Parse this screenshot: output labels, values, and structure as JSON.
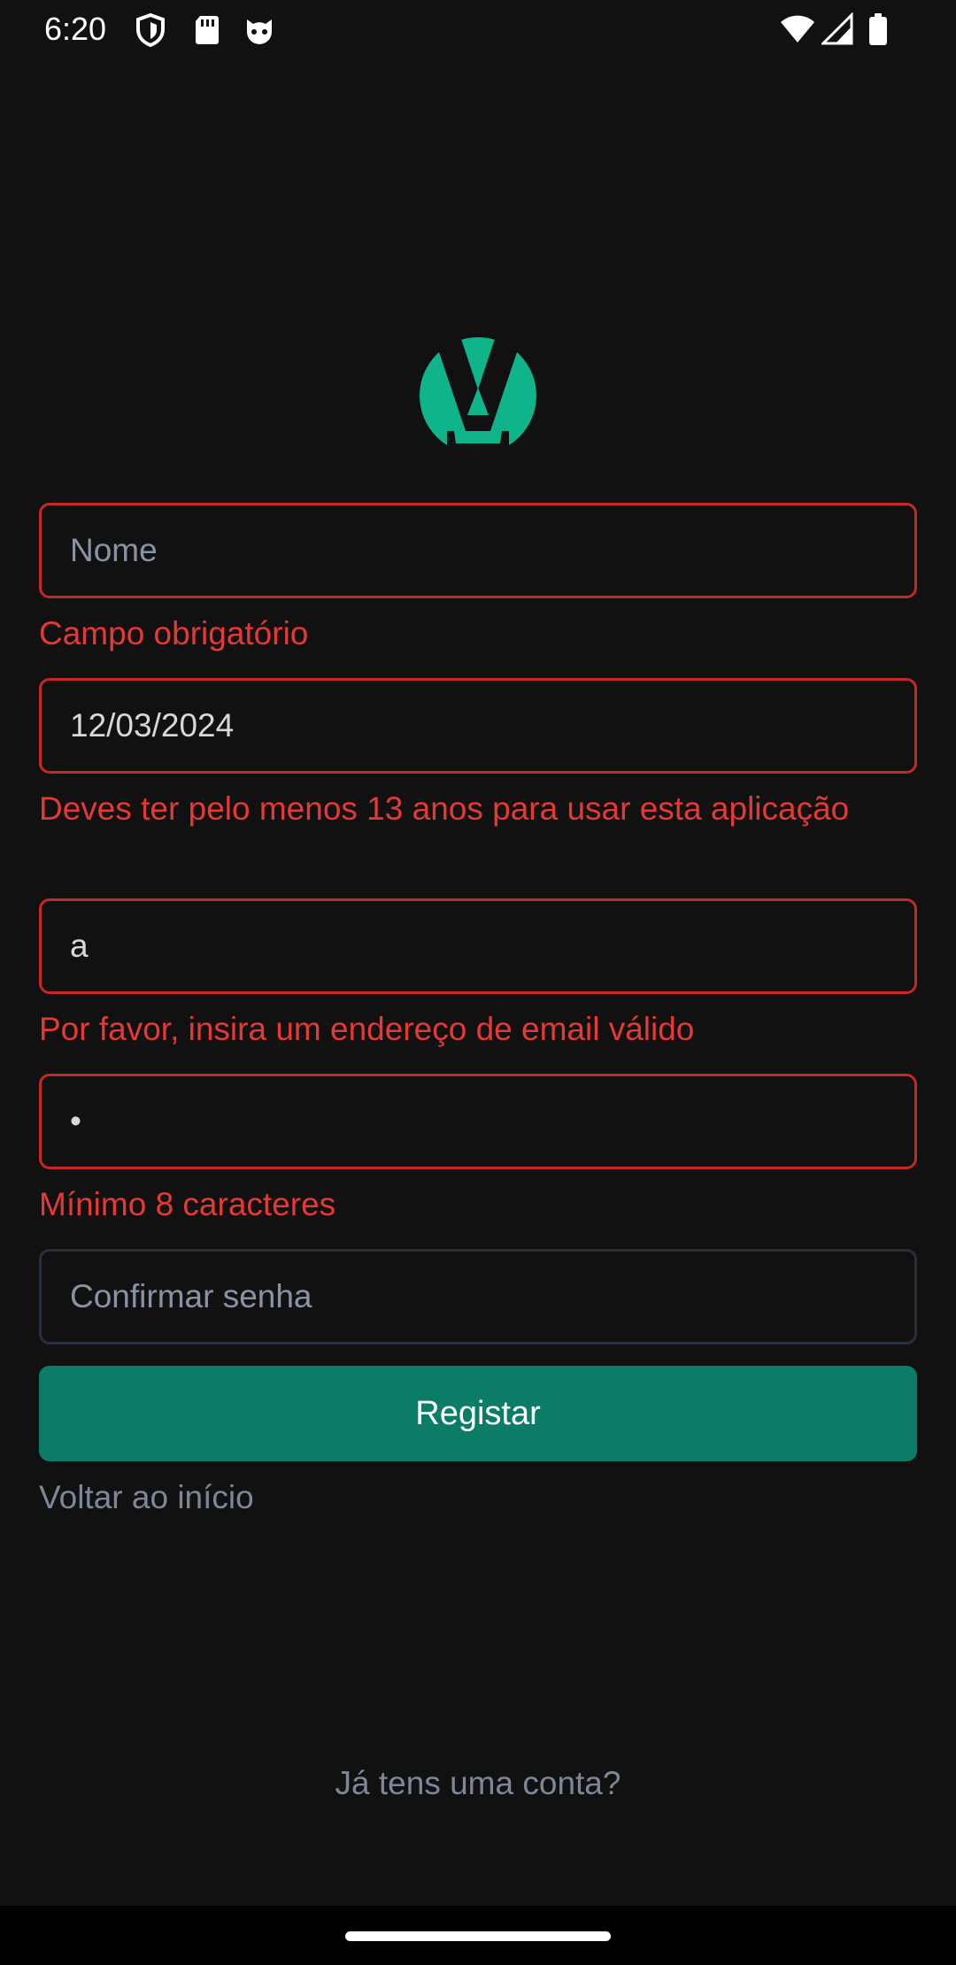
{
  "status_bar": {
    "time": "6:20",
    "left_icons": [
      "shield-icon",
      "sd-card-icon",
      "cat-face-icon"
    ],
    "right_icons": [
      "wifi-icon",
      "cell-signal-icon",
      "battery-icon"
    ]
  },
  "logo": {
    "icon": "app-logo-icon",
    "color": "#10b48a"
  },
  "form": {
    "name": {
      "value": "",
      "placeholder": "Nome",
      "error": "Campo obrigatório"
    },
    "birthdate": {
      "value": "12/03/2024",
      "error": "Deves ter pelo menos 13 anos para usar esta aplicação"
    },
    "email": {
      "value": "a",
      "error": "Por favor, insira um endereço de email válido"
    },
    "password": {
      "value": "•",
      "error": "Mínimo 8 caracteres"
    },
    "confirm_password": {
      "value": "",
      "placeholder": "Confirmar senha"
    },
    "submit_label": "Registar",
    "back_label": "Voltar ao início"
  },
  "footer": {
    "account_link": "Já tens uma conta?"
  },
  "colors": {
    "background": "#111111",
    "error": "#e53935",
    "error_border": "#c62828",
    "primary": "#0b7d66",
    "muted_text": "#7e8699"
  }
}
